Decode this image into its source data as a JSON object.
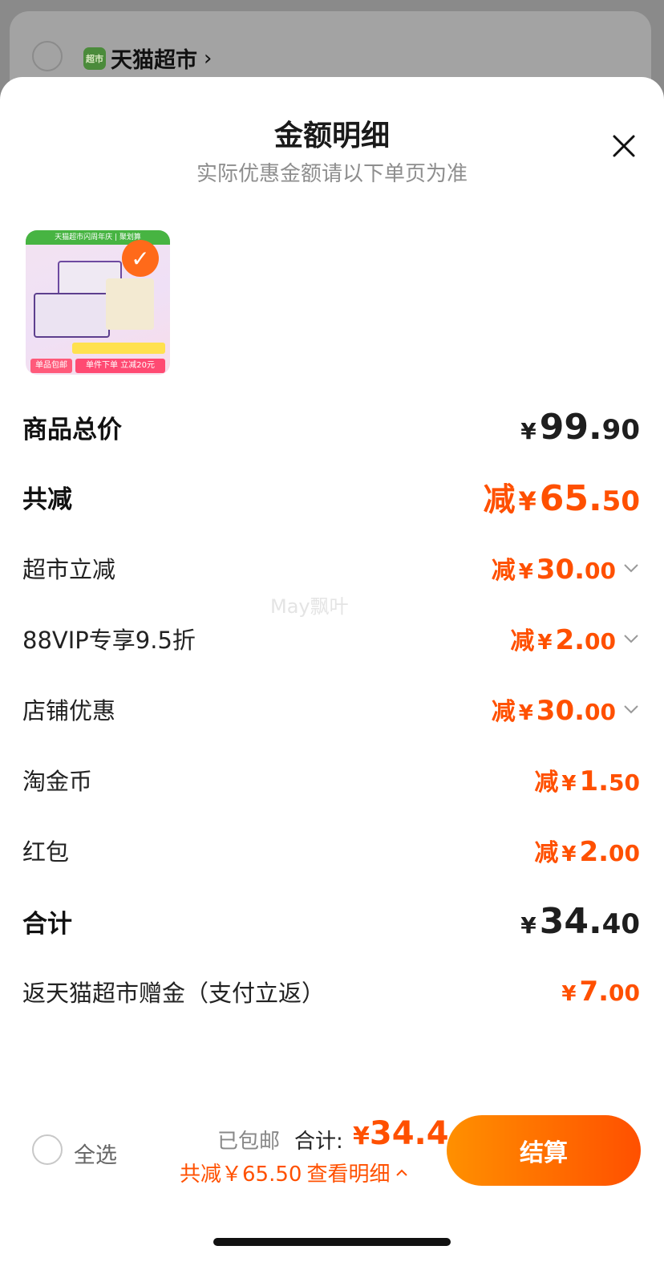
{
  "background": {
    "store_logo_text": "超市",
    "store_name": "天猫超市",
    "store_chevron": "›"
  },
  "sheet": {
    "title": "金额明细",
    "subtitle": "实际优惠金额请以下单页为准"
  },
  "product_thumb": {
    "banner_text": "天猫超市闪周年庆 | 聚划算",
    "tag_left": "单品包邮",
    "tag_right": "单件下单 立减20元",
    "selected": true
  },
  "rows": {
    "subtotal": {
      "label": "商品总价",
      "currency": "¥",
      "int": "99.",
      "dec": "90"
    },
    "total_discount": {
      "label": "共减",
      "prefix": "减",
      "currency": "¥",
      "int": "65.",
      "dec": "50"
    },
    "supermarket_discount": {
      "label": "超市立减",
      "prefix": "减",
      "currency": "¥",
      "int": "30.",
      "dec": "00"
    },
    "vip_discount": {
      "label": "88VIP专享9.5折",
      "prefix": "减",
      "currency": "¥",
      "int": "2.",
      "dec": "00"
    },
    "store_discount": {
      "label": "店铺优惠",
      "prefix": "减",
      "currency": "¥",
      "int": "30.",
      "dec": "00"
    },
    "taojinbi": {
      "label": "淘金币",
      "prefix": "减",
      "currency": "¥",
      "int": "1.",
      "dec": "50"
    },
    "red_packet": {
      "label": "红包",
      "prefix": "减",
      "currency": "¥",
      "int": "2.",
      "dec": "00"
    },
    "total": {
      "label": "合计",
      "currency": "¥",
      "int": "34.",
      "dec": "40"
    },
    "cashback": {
      "label": "返天猫超市赠金（支付立返）",
      "currency": "¥",
      "int": "7.",
      "dec": "00"
    }
  },
  "watermark": "May飘叶",
  "footer": {
    "select_all": "全选",
    "shipping": "已包邮",
    "total_label": "合计:",
    "total_currency": "¥",
    "total_value": "34.4",
    "saved_text": "共减￥65.50",
    "detail_link": "查看明细",
    "checkout_label": "结算"
  },
  "colors": {
    "accent": "#ff5000",
    "accent_gradient_start": "#ff9000"
  }
}
